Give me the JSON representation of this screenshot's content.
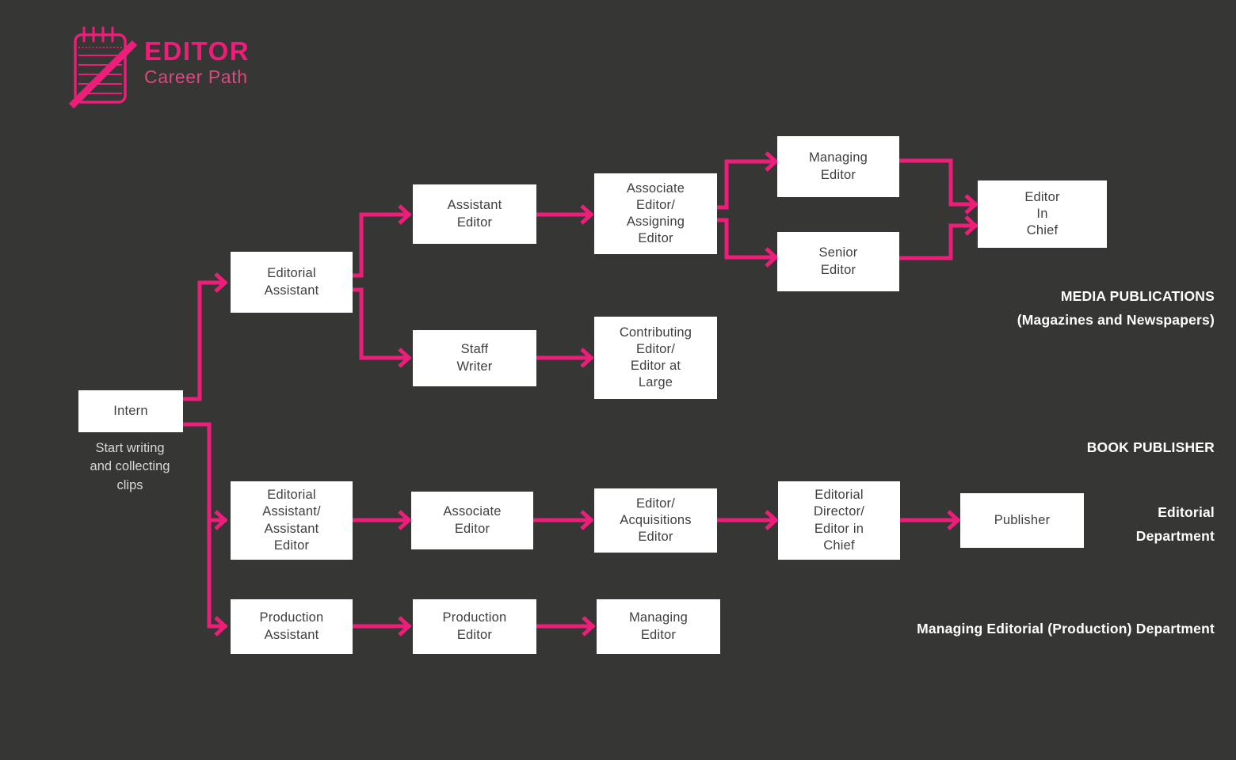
{
  "theme": {
    "background": "#363634",
    "accent": "#EC1E79",
    "accent_soft": "#D94A82",
    "node_fill": "#ffffff",
    "node_text": "#3f3f3f",
    "label_text": "#ffffff",
    "caption_text": "#d8d8d6"
  },
  "logo": {
    "icon": "notepad-pencil-icon",
    "title": "EDITOR",
    "subtitle": "Career Path"
  },
  "chart_data": {
    "type": "diagram",
    "title": "EDITOR Career Path",
    "nodes": [
      {
        "id": "intern",
        "label": "Intern"
      },
      {
        "id": "editorial-assistant",
        "label": "Editorial\nAssistant"
      },
      {
        "id": "assistant-editor",
        "label": "Assistant\nEditor"
      },
      {
        "id": "associate-assigning-editor",
        "label": "Associate\nEditor/\nAssigning\nEditor"
      },
      {
        "id": "managing-editor-media",
        "label": "Managing\nEditor"
      },
      {
        "id": "senior-editor",
        "label": "Senior\nEditor"
      },
      {
        "id": "editor-in-chief",
        "label": "Editor\nIn\nChief"
      },
      {
        "id": "staff-writer",
        "label": "Staff\nWriter"
      },
      {
        "id": "contributing-editor",
        "label": "Contributing\nEditor/\nEditor at\nLarge"
      },
      {
        "id": "editorial-assistant-assistant-editor",
        "label": "Editorial\nAssistant/\nAssistant\nEditor"
      },
      {
        "id": "associate-editor-book",
        "label": "Associate\nEditor"
      },
      {
        "id": "editor-acquisitions",
        "label": "Editor/\nAcquisitions\nEditor"
      },
      {
        "id": "editorial-director",
        "label": "Editorial\nDirector/\nEditor in\nChief"
      },
      {
        "id": "publisher",
        "label": "Publisher"
      },
      {
        "id": "production-assistant",
        "label": "Production\nAssistant"
      },
      {
        "id": "production-editor",
        "label": "Production\nEditor"
      },
      {
        "id": "managing-editor-production",
        "label": "Managing\nEditor"
      }
    ],
    "edges": [
      {
        "from": "intern",
        "to": "editorial-assistant"
      },
      {
        "from": "intern",
        "to": "editorial-assistant-assistant-editor"
      },
      {
        "from": "intern",
        "to": "production-assistant"
      },
      {
        "from": "editorial-assistant",
        "to": "assistant-editor"
      },
      {
        "from": "editorial-assistant",
        "to": "staff-writer"
      },
      {
        "from": "assistant-editor",
        "to": "associate-assigning-editor"
      },
      {
        "from": "associate-assigning-editor",
        "to": "managing-editor-media"
      },
      {
        "from": "associate-assigning-editor",
        "to": "senior-editor"
      },
      {
        "from": "managing-editor-media",
        "to": "editor-in-chief"
      },
      {
        "from": "senior-editor",
        "to": "editor-in-chief"
      },
      {
        "from": "staff-writer",
        "to": "contributing-editor"
      },
      {
        "from": "editorial-assistant-assistant-editor",
        "to": "associate-editor-book"
      },
      {
        "from": "associate-editor-book",
        "to": "editor-acquisitions"
      },
      {
        "from": "editor-acquisitions",
        "to": "editorial-director"
      },
      {
        "from": "editorial-director",
        "to": "publisher"
      },
      {
        "from": "production-assistant",
        "to": "production-editor"
      },
      {
        "from": "production-editor",
        "to": "managing-editor-production"
      }
    ],
    "annotations": [
      {
        "id": "intern-caption",
        "text": "Start writing\nand collecting\nclips"
      }
    ],
    "sections": [
      {
        "id": "media-publications",
        "text": "MEDIA PUBLICATIONS\n(Magazines and Newspapers)"
      },
      {
        "id": "book-publisher",
        "text": "BOOK PUBLISHER"
      },
      {
        "id": "editorial-department",
        "text": "Editorial\nDepartment"
      },
      {
        "id": "managing-editorial-department",
        "text": "Managing Editorial (Production) Department"
      }
    ]
  },
  "nodes": {
    "intern": "Intern",
    "editorial_assistant": "Editorial\nAssistant",
    "assistant_editor": "Assistant\nEditor",
    "associate_assigning_editor": "Associate\nEditor/\nAssigning\nEditor",
    "managing_editor_media": "Managing\nEditor",
    "senior_editor": "Senior\nEditor",
    "editor_in_chief": "Editor\nIn\nChief",
    "staff_writer": "Staff\nWriter",
    "contributing_editor": "Contributing\nEditor/\nEditor at\nLarge",
    "editorial_assistant_assistant_editor": "Editorial\nAssistant/\nAssistant\nEditor",
    "associate_editor_book": "Associate\nEditor",
    "editor_acquisitions": "Editor/\nAcquisitions\nEditor",
    "editorial_director": "Editorial\nDirector/\nEditor in\nChief",
    "publisher": "Publisher",
    "production_assistant": "Production\nAssistant",
    "production_editor": "Production\nEditor",
    "managing_editor_production": "Managing\nEditor"
  },
  "captions": {
    "intern": "Start writing\nand collecting\nclips"
  },
  "sections": {
    "media_publications": "MEDIA PUBLICATIONS\n(Magazines and Newspapers)",
    "book_publisher": "BOOK PUBLISHER",
    "editorial_department": "Editorial\nDepartment",
    "managing_editorial_department": "Managing Editorial (Production) Department"
  }
}
